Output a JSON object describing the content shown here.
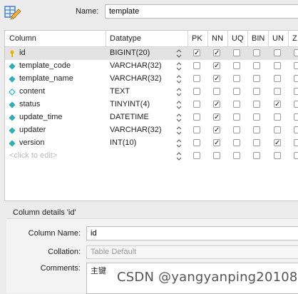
{
  "name_label": "Name:",
  "name_value": "template",
  "columns_header": [
    "Column",
    "Datatype",
    "PK",
    "NN",
    "UQ",
    "BIN",
    "UN",
    "Z"
  ],
  "rows": [
    {
      "name": "id",
      "type": "BIGINT(20)",
      "icon": "key-icon",
      "pk": true,
      "nn": true,
      "uq": false,
      "bin": false,
      "un": false
    },
    {
      "name": "template_code",
      "type": "VARCHAR(32)",
      "icon": "diamond-filled-icon",
      "pk": false,
      "nn": true,
      "uq": false,
      "bin": false,
      "un": false
    },
    {
      "name": "template_name",
      "type": "VARCHAR(32)",
      "icon": "diamond-filled-icon",
      "pk": false,
      "nn": true,
      "uq": false,
      "bin": false,
      "un": false
    },
    {
      "name": "content",
      "type": "TEXT",
      "icon": "diamond-outline-icon",
      "pk": false,
      "nn": false,
      "uq": false,
      "bin": false,
      "un": false
    },
    {
      "name": "status",
      "type": "TINYINT(4)",
      "icon": "diamond-filled-icon",
      "pk": false,
      "nn": true,
      "uq": false,
      "bin": false,
      "un": true
    },
    {
      "name": "update_time",
      "type": "DATETIME",
      "icon": "diamond-filled-icon",
      "pk": false,
      "nn": true,
      "uq": false,
      "bin": false,
      "un": false
    },
    {
      "name": "updater",
      "type": "VARCHAR(32)",
      "icon": "diamond-filled-icon",
      "pk": false,
      "nn": true,
      "uq": false,
      "bin": false,
      "un": false
    },
    {
      "name": "version",
      "type": "INT(10)",
      "icon": "diamond-filled-icon",
      "pk": false,
      "nn": true,
      "uq": false,
      "bin": false,
      "un": true
    }
  ],
  "placeholder_row": "<click to edit>",
  "details": {
    "title": "Column details 'id'",
    "column_name_label": "Column Name:",
    "column_name_value": "id",
    "collation_label": "Collation:",
    "collation_value": "Table Default",
    "comments_label": "Comments:",
    "comments_value": "主键"
  },
  "watermark": "CSDN @yangyanping20108",
  "colors": {
    "accent_diamond": "#2bb3c0",
    "key": "#e8b400",
    "selected_row": "#e3e3e3"
  }
}
